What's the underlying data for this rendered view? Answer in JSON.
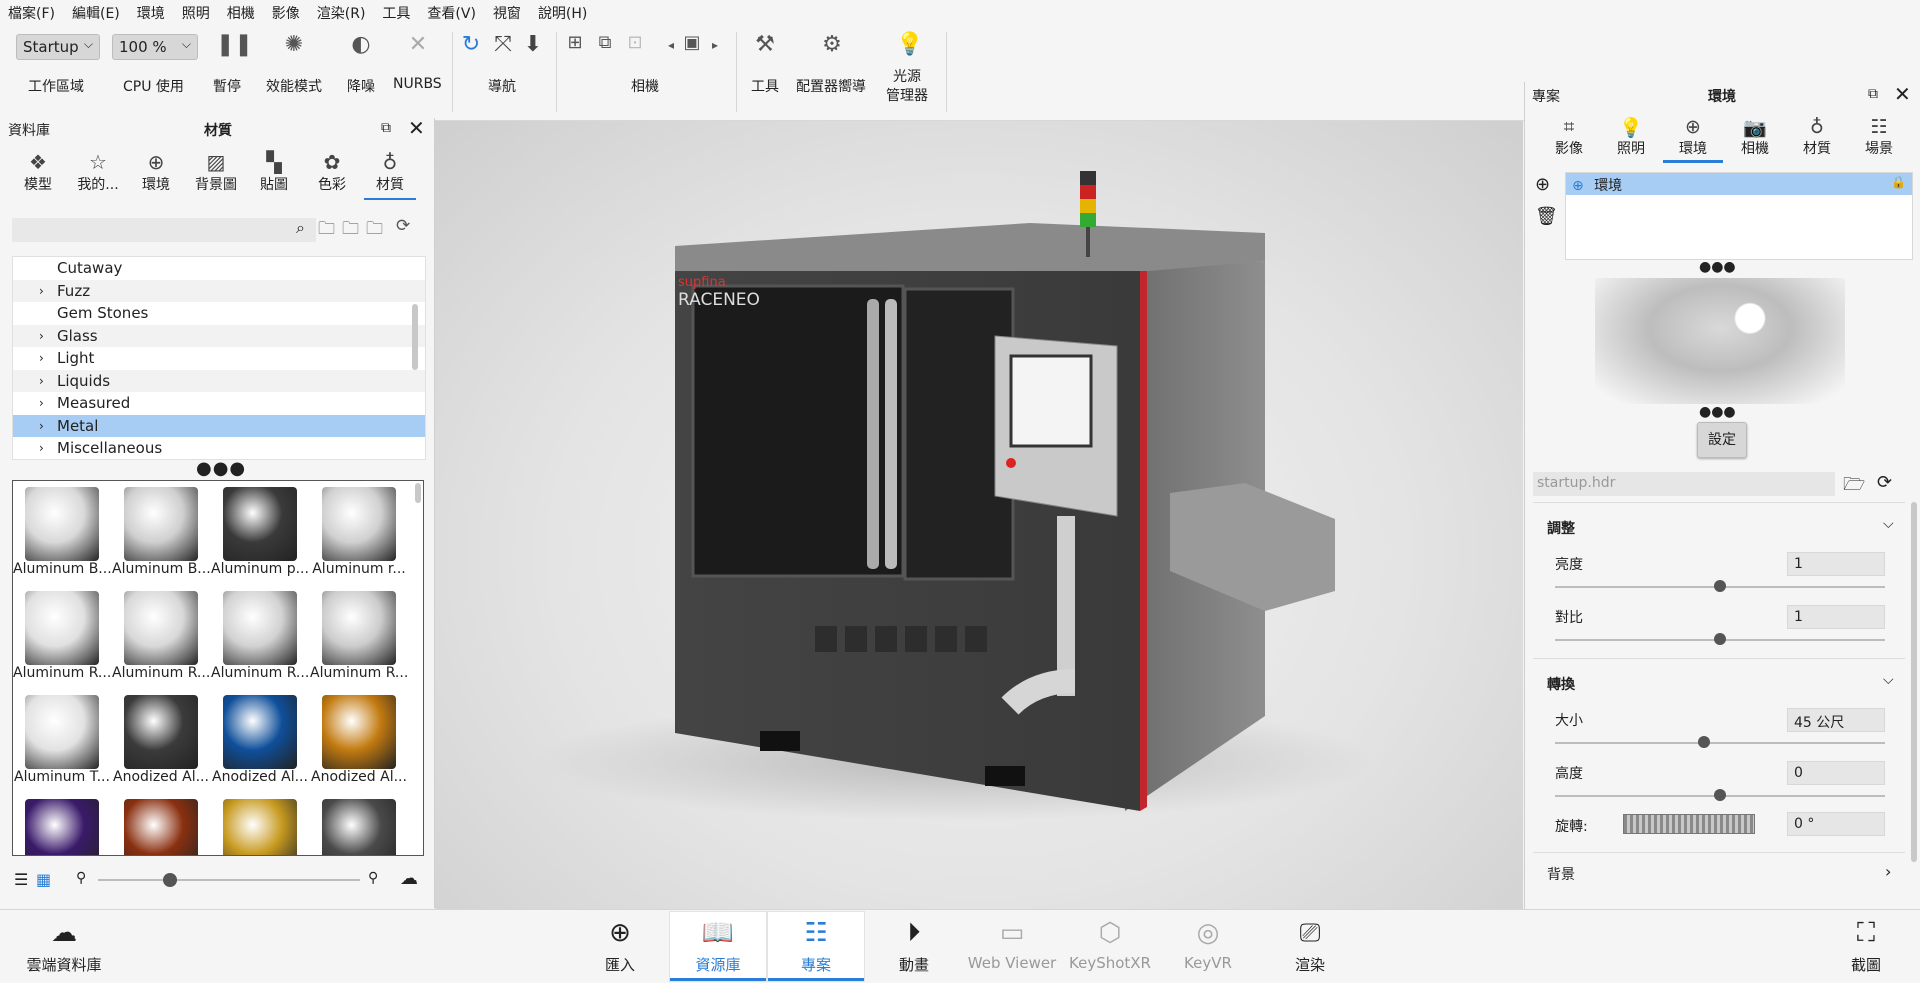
{
  "menu": [
    "檔案(F)",
    "編輯(E)",
    "環境",
    "照明",
    "相機",
    "影像",
    "渲染(R)",
    "工具",
    "查看(V)",
    "視窗",
    "說明(H)"
  ],
  "toolbar": {
    "workspace_value": "Startup",
    "workspace_label": "工作區域",
    "cpu_value": "100 %",
    "cpu_label": "CPU 使用",
    "pause_label": "暫停",
    "perf_label": "效能模式",
    "denoise_label": "降噪",
    "nurbs_label": "NURBS",
    "nav_label": "導航",
    "camera_label": "相機",
    "tools_label": "工具",
    "configurator_label": "配置器嚮導",
    "light_manager_label_1": "光源",
    "light_manager_label_2": "管理器"
  },
  "library": {
    "title": "資料庫",
    "subtitle": "材質",
    "tabs": [
      {
        "label": "模型",
        "icon": "models-icon"
      },
      {
        "label": "我的...",
        "icon": "star-icon"
      },
      {
        "label": "環境",
        "icon": "globe-icon"
      },
      {
        "label": "背景圖",
        "icon": "image-icon"
      },
      {
        "label": "貼圖",
        "icon": "checker-icon"
      },
      {
        "label": "色彩",
        "icon": "palette-icon"
      },
      {
        "label": "材質",
        "icon": "material-ball-icon"
      }
    ],
    "search_placeholder": "",
    "tree": [
      {
        "label": "Cutaway",
        "expandable": false
      },
      {
        "label": "Fuzz",
        "expandable": true
      },
      {
        "label": "Gem Stones",
        "expandable": false
      },
      {
        "label": "Glass",
        "expandable": true
      },
      {
        "label": "Light",
        "expandable": true
      },
      {
        "label": "Liquids",
        "expandable": true
      },
      {
        "label": "Measured",
        "expandable": true
      },
      {
        "label": "Metal",
        "expandable": true,
        "selected": true
      },
      {
        "label": "Miscellaneous",
        "expandable": true
      }
    ],
    "thumbnails": [
      {
        "label": "Aluminum B...",
        "color": "#d9d9d9"
      },
      {
        "label": "Aluminum B...",
        "color": "#cfcfcf"
      },
      {
        "label": "Aluminum p...",
        "color": "#3a3a3a"
      },
      {
        "label": "Aluminum r...",
        "color": "#d0d0d0"
      },
      {
        "label": "Aluminum R...",
        "color": "#e0e0e0"
      },
      {
        "label": "Aluminum R...",
        "color": "#d8d8d8"
      },
      {
        "label": "Aluminum R...",
        "color": "#d2d2d2"
      },
      {
        "label": "Aluminum R...",
        "color": "#cccccc"
      },
      {
        "label": "Aluminum T...",
        "color": "#e2e2e2"
      },
      {
        "label": "Anodized Al...",
        "color": "#3b3b3b"
      },
      {
        "label": "Anodized Al...",
        "color": "#0f4f9a"
      },
      {
        "label": "Anodized Al...",
        "color": "#c27a10"
      },
      {
        "label": "",
        "color": "#3a1a6a"
      },
      {
        "label": "",
        "color": "#8a3010"
      },
      {
        "label": "",
        "color": "#c79a20"
      },
      {
        "label": "",
        "color": "#4a4a4a"
      }
    ]
  },
  "project": {
    "title": "專案",
    "subtitle": "環境",
    "tabs": [
      {
        "label": "影像",
        "icon": "crop-icon"
      },
      {
        "label": "照明",
        "icon": "bulb-icon"
      },
      {
        "label": "環境",
        "icon": "globe-icon",
        "active": true
      },
      {
        "label": "相機",
        "icon": "camera-icon"
      },
      {
        "label": "材質",
        "icon": "material-ball-icon"
      },
      {
        "label": "場景",
        "icon": "list-icon"
      }
    ],
    "env_item": "環境",
    "settings_button": "設定",
    "hdr_file": "startup.hdr",
    "adjust": {
      "title": "調整",
      "brightness_label": "亮度",
      "brightness_value": "1",
      "brightness_level": 0.5,
      "contrast_label": "對比",
      "contrast_value": "1",
      "contrast_level": 0.5
    },
    "transform": {
      "title": "轉換",
      "size_label": "大小",
      "size_value": "45 公尺",
      "size_level": 0.45,
      "height_label": "高度",
      "height_value": "0",
      "height_level": 0.5,
      "rotation_label": "旋轉:",
      "rotation_value": "0 °"
    },
    "background_title": "背景"
  },
  "bottombar": {
    "cloud_label": "雲端資料庫",
    "import_label": "匯入",
    "library_label": "資源庫",
    "project_label": "專案",
    "animation_label": "動畫",
    "webviewer_label": "Web Viewer",
    "keyshotxr_label": "KeyShotXR",
    "keyvr_label": "KeyVR",
    "render_label": "渲染",
    "screenshot_label": "截圖"
  },
  "colors": {
    "accent": "#2a7dd6",
    "selection": "#a8cdf5"
  }
}
